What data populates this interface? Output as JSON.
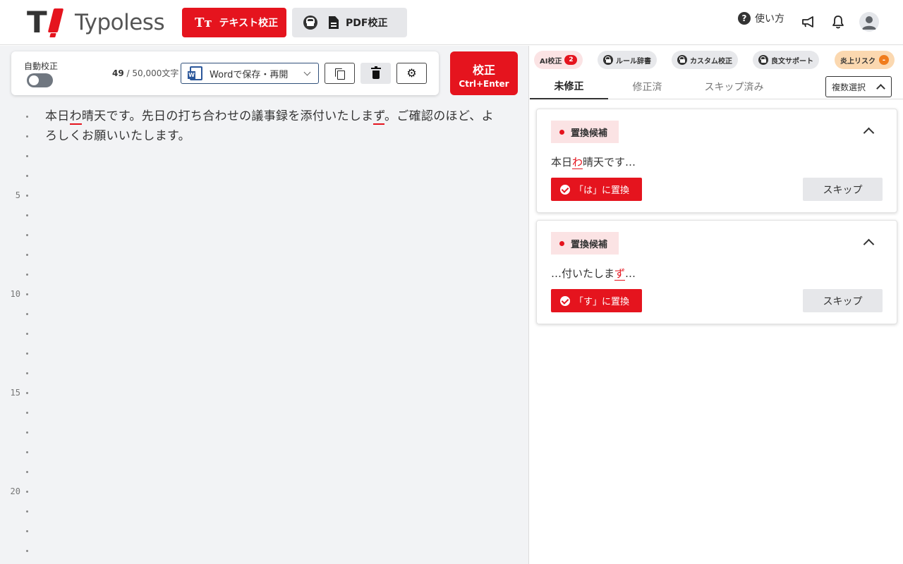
{
  "header": {
    "logo_text_light": "Typo",
    "logo_text_bold": "less",
    "logo_mark": "T",
    "text_check_label": "テキスト校正",
    "text_check_icon": "Tт",
    "pdf_check_label": "PDF校正",
    "help_label": "使い方",
    "help_icon": "?"
  },
  "toolbar": {
    "auto_label": "自動校正",
    "auto_enabled": false,
    "char_count": "49",
    "char_limit": "/ 50,000文字",
    "word_button_label": "Wordで保存・再開",
    "gear_glyph": "⚙",
    "proof_label": "校正",
    "proof_shortcut": "Ctrl+Enter"
  },
  "editor": {
    "line1_a": "本日",
    "line1_err1": "わ",
    "line1_b": "晴天です。先日の打ち合わせの議事録を添付いたしま",
    "line1_err2": "ず",
    "line1_c": "。ご確認のほど、よ",
    "line2": "ろしくお願いいたします。",
    "line_numbers": [
      "",
      "",
      "",
      "",
      "5",
      "",
      "",
      "",
      "",
      "10",
      "",
      "",
      "",
      "",
      "15",
      "",
      "",
      "",
      "",
      "20",
      "",
      "",
      ""
    ]
  },
  "right_panel": {
    "chips": {
      "ai_label": "AI校正",
      "ai_count": "2",
      "rule_label": "ルール辞書",
      "custom_label": "カスタム校正",
      "support_label": "良文サポート",
      "flame_label": "炎上リスク",
      "flame_badge": "-"
    },
    "tabs": {
      "unfixed": "未修正",
      "fixed": "修正済",
      "skipped": "スキップ済み"
    },
    "multi_select_label": "複数選択",
    "cards": [
      {
        "tag": "置換候補",
        "snippet_before": "本日",
        "snippet_err": "わ",
        "snippet_after": "晴天です…",
        "replace_label": "「は」に置換",
        "skip_label": "スキップ"
      },
      {
        "tag": "置換候補",
        "snippet_before": "…付いたしま",
        "snippet_err": "ず",
        "snippet_after": "…",
        "replace_label": "「す」に置換",
        "skip_label": "スキップ"
      }
    ]
  },
  "colors": {
    "brand_red": "#e5141e",
    "editor_bg": "#f2f3f5",
    "flame_orange": "#f07c1c"
  }
}
